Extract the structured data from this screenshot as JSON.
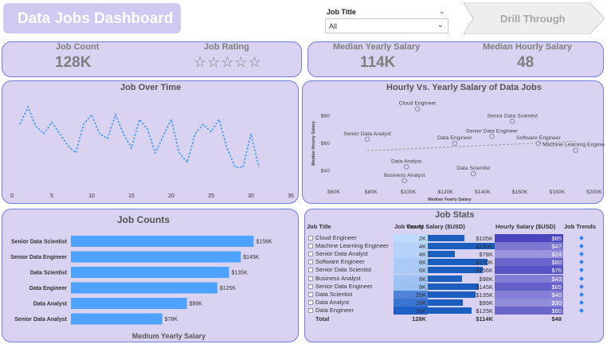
{
  "header": {
    "title": "Data Jobs Dashboard",
    "drill_label": "Drill Through"
  },
  "slicer": {
    "label": "Job Title",
    "value": "All"
  },
  "kpis": {
    "job_count_label": "Job Count",
    "job_count_value": "128K",
    "job_rating_label": "Job Rating",
    "job_rating_stars": "☆☆☆☆☆",
    "median_yearly_label": "Median Yearly Salary",
    "median_yearly_value": "114K",
    "median_hourly_label": "Median Hourly Salary",
    "median_hourly_value": "48"
  },
  "colors": {
    "panel": "#d9d2f1",
    "border": "#6f7fd9",
    "bar": "#4da3ff",
    "line": "#3a9cff"
  },
  "chart_data": [
    {
      "type": "line",
      "title": "Job Over Time",
      "x_ticks": [
        "0",
        "5",
        "10",
        "15",
        "20",
        "25",
        "30",
        "35"
      ],
      "xlim": [
        0,
        35
      ],
      "ylim": [
        0,
        100
      ],
      "x": [
        1,
        2,
        3,
        4,
        5,
        6,
        7,
        8,
        9,
        10,
        11,
        12,
        13,
        14,
        15,
        16,
        17,
        18,
        19,
        20,
        21,
        22,
        23,
        24,
        25,
        26,
        27,
        28,
        29,
        30,
        31
      ],
      "values": [
        70,
        88,
        68,
        60,
        72,
        60,
        48,
        40,
        70,
        80,
        60,
        55,
        80,
        60,
        45,
        75,
        65,
        40,
        58,
        75,
        40,
        30,
        60,
        70,
        62,
        75,
        45,
        25,
        25,
        60,
        25
      ]
    },
    {
      "type": "scatter",
      "title": "Hourly Vs. Yearly Salary of Data Jobs",
      "xlabel": "Median Yearly Salary",
      "ylabel": "Median Hourly Salary",
      "x_ticks": [
        "$60K",
        "$80K",
        "$100K",
        "$120K",
        "$140K",
        "$160K",
        "$180K",
        "$200K"
      ],
      "y_ticks": [
        "$40",
        "$60",
        "$80"
      ],
      "xlim": [
        60000,
        200000
      ],
      "ylim": [
        30,
        90
      ],
      "points": [
        {
          "label": "Cloud Engineer",
          "x": 105000,
          "y": 85
        },
        {
          "label": "Senior Data Scientist",
          "x": 156000,
          "y": 76
        },
        {
          "label": "Senior Data Engineer",
          "x": 145000,
          "y": 65
        },
        {
          "label": "Software Engineer",
          "x": 170000,
          "y": 60
        },
        {
          "label": "Machine Learning Engineer",
          "x": 190000,
          "y": 55
        },
        {
          "label": "Senior Data Analyst",
          "x": 78000,
          "y": 63
        },
        {
          "label": "Data Engineer",
          "x": 125000,
          "y": 60
        },
        {
          "label": "Data Analyst",
          "x": 99000,
          "y": 43
        },
        {
          "label": "Business Analyst",
          "x": 98000,
          "y": 33
        },
        {
          "label": "Data Scientist",
          "x": 135000,
          "y": 38
        }
      ]
    },
    {
      "type": "bar",
      "title": "Job Counts",
      "xlabel": "Medium Yearly Salary",
      "categories": [
        "Senior Data Scientist",
        "Senior Data Engineer",
        "Data Scientist",
        "Data Engineer",
        "Data Analyst",
        "Senior Data Analyst"
      ],
      "values": [
        156000,
        145000,
        135000,
        125000,
        99000,
        78000
      ],
      "value_labels": [
        "$156K",
        "$145K",
        "$135K",
        "$125K",
        "$99K",
        "$78K"
      ],
      "xlim": [
        0,
        170000
      ]
    },
    {
      "type": "table",
      "title": "Job Stats",
      "columns": [
        "Job Title",
        "Job Count",
        "Yearly Salary ($USD)",
        "Hourly Salary ($USD)",
        "Job Trends"
      ],
      "rows": [
        {
          "title": "Cloud Engineer",
          "count": "2K",
          "count_v": 2,
          "yearly": "$105K",
          "yearly_v": 105,
          "hourly": "$85",
          "hourly_v": 85
        },
        {
          "title": "Machine Learning Engineer",
          "count": "4K",
          "count_v": 4,
          "yearly": "$190K",
          "yearly_v": 190,
          "hourly": "$47",
          "hourly_v": 47
        },
        {
          "title": "Senior Data Analyst",
          "count": "4K",
          "count_v": 4,
          "yearly": "$78K",
          "yearly_v": 78,
          "hourly": "$24",
          "hourly_v": 24
        },
        {
          "title": "Software Engineer",
          "count": "6K",
          "count_v": 6,
          "yearly": "$170K",
          "yearly_v": 170,
          "hourly": "$60",
          "hourly_v": 60
        },
        {
          "title": "Senior Data Scientist",
          "count": "6K",
          "count_v": 6,
          "yearly": "$156K",
          "yearly_v": 156,
          "hourly": "$76",
          "hourly_v": 76
        },
        {
          "title": "Business Analyst",
          "count": "8K",
          "count_v": 8,
          "yearly": "$98K",
          "yearly_v": 98,
          "hourly": "$43",
          "hourly_v": 43
        },
        {
          "title": "Senior Data Engineer",
          "count": "9K",
          "count_v": 9,
          "yearly": "$145K",
          "yearly_v": 145,
          "hourly": "$65",
          "hourly_v": 65
        },
        {
          "title": "Data Scientist",
          "count": "25K",
          "count_v": 25,
          "yearly": "$135K",
          "yearly_v": 135,
          "hourly": "$40",
          "hourly_v": 40
        },
        {
          "title": "Data Analyst",
          "count": "29K",
          "count_v": 29,
          "yearly": "$99K",
          "yearly_v": 99,
          "hourly": "$30",
          "hourly_v": 30
        },
        {
          "title": "Data Engineer",
          "count": "35K",
          "count_v": 35,
          "yearly": "$125K",
          "yearly_v": 125,
          "hourly": "$60",
          "hourly_v": 60
        }
      ],
      "total": {
        "title": "Total",
        "count": "128K",
        "yearly": "$114K",
        "hourly": "$48"
      }
    }
  ]
}
